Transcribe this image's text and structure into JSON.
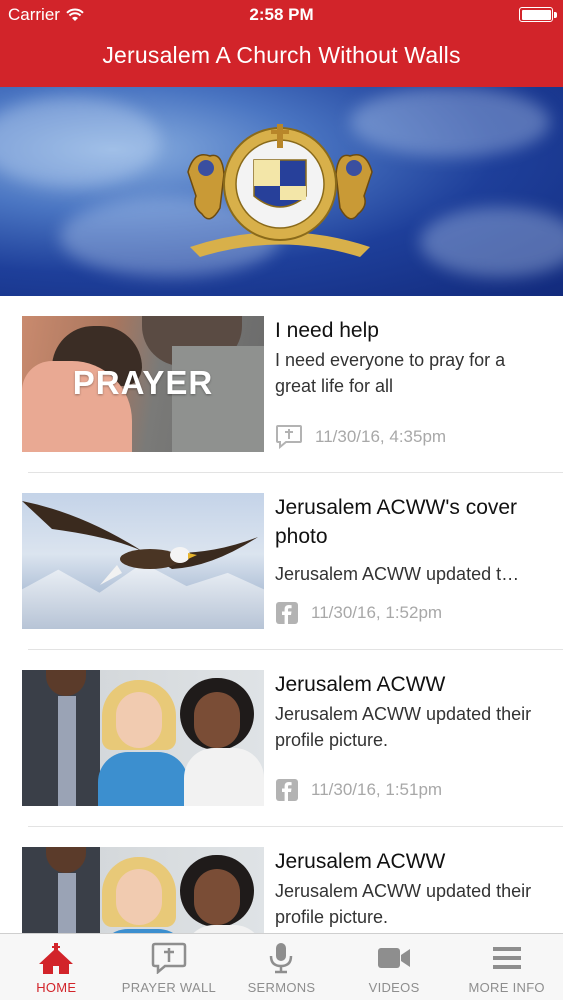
{
  "status_bar": {
    "carrier": "Carrier",
    "time": "2:58 PM"
  },
  "header": {
    "title": "Jerusalem A Church Without Walls"
  },
  "feed": [
    {
      "title": "I need help",
      "body": "I need everyone to pray for a great life for all",
      "source_icon": "prayer-wall-icon",
      "timestamp": "11/30/16, 4:35pm",
      "thumb_caption": "PRAYER"
    },
    {
      "title": "Jerusalem ACWW's cover photo",
      "body": "Jerusalem ACWW updated t…",
      "source_icon": "facebook-icon",
      "timestamp": "11/30/16, 1:52pm"
    },
    {
      "title": "Jerusalem ACWW",
      "body": "Jerusalem ACWW updated their profile picture.",
      "source_icon": "facebook-icon",
      "timestamp": "11/30/16, 1:51pm"
    },
    {
      "title": "Jerusalem ACWW",
      "body": "Jerusalem ACWW updated their profile picture.",
      "source_icon": "facebook-icon",
      "timestamp": ""
    }
  ],
  "tabs": [
    {
      "label": "HOME",
      "icon": "home-icon",
      "active": true
    },
    {
      "label": "PRAYER WALL",
      "icon": "prayer-wall-icon",
      "active": false
    },
    {
      "label": "SERMONS",
      "icon": "microphone-icon",
      "active": false
    },
    {
      "label": "VIDEOS",
      "icon": "video-camera-icon",
      "active": false
    },
    {
      "label": "MORE INFO",
      "icon": "menu-icon",
      "active": false
    }
  ],
  "colors": {
    "brand_red": "#d2242a",
    "tab_inactive": "#8e8e8e",
    "meta_gray": "#a8a8a8"
  }
}
